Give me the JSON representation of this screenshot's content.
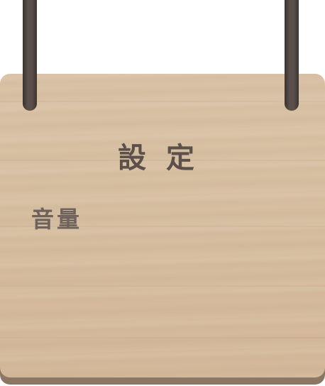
{
  "panel": {
    "title": "設定",
    "volume_label": "音量"
  },
  "colors": {
    "rope": "#4f4541",
    "wood": "#d7bfa2",
    "board_edge": "#8c7763",
    "title_text": "#5b504a",
    "label_text": "#6e625c"
  }
}
